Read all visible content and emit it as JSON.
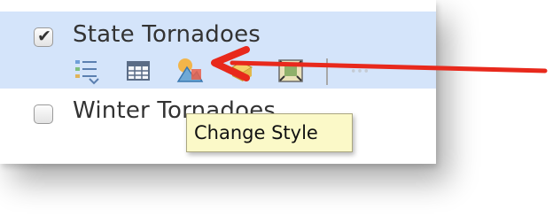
{
  "layers": [
    {
      "label": "State Tornadoes",
      "checked": true,
      "selected": true
    },
    {
      "label": "Winter Tornadoes",
      "checked": false,
      "selected": false
    }
  ],
  "toolbar": {
    "icons": [
      "legend-icon",
      "table-icon",
      "change-style-icon",
      "effects-icon",
      "extent-icon",
      "more-icon"
    ]
  },
  "checkbox": {
    "mark": "✔"
  },
  "tooltip": {
    "text": "Change Style"
  },
  "colors": {
    "selected_row": "#d4e4fa",
    "tooltip_bg": "#fbf9c8",
    "annotation_arrow": "#e8291c"
  }
}
